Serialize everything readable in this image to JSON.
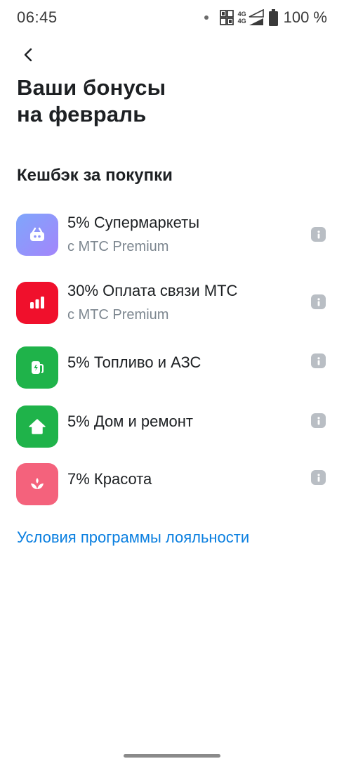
{
  "status_bar": {
    "time": "06:45",
    "network_top": "4G",
    "network_bottom": "4G",
    "battery": "100 %"
  },
  "header": {
    "title": "Ваши бонусы\nна февраль"
  },
  "cashback": {
    "section_title": "Кешбэк за покупки",
    "items": [
      {
        "title": "5% Супермаркеты",
        "subtitle": "с МТС Premium",
        "icon": "shopping-basket-icon",
        "color": "#8a8dfb"
      },
      {
        "title": "30% Оплата связи МТС",
        "subtitle": "с МТС Premium",
        "icon": "bar-chart-icon",
        "color": "#f0102c"
      },
      {
        "title": "5% Топливо и АЗС",
        "subtitle": "",
        "icon": "fuel-pump-icon",
        "color": "#1fb34a"
      },
      {
        "title": "5% Дом и ремонт",
        "subtitle": "",
        "icon": "house-icon",
        "color": "#1fb34a"
      },
      {
        "title": "7% Красота",
        "subtitle": "",
        "icon": "flower-icon",
        "color": "#f4627c"
      }
    ]
  },
  "footer": {
    "loyalty_link": "Условия программы лояльности"
  },
  "colors": {
    "link": "#0a7fe0",
    "secondary_text": "#7d8790",
    "info_button": "#b9bec4"
  }
}
